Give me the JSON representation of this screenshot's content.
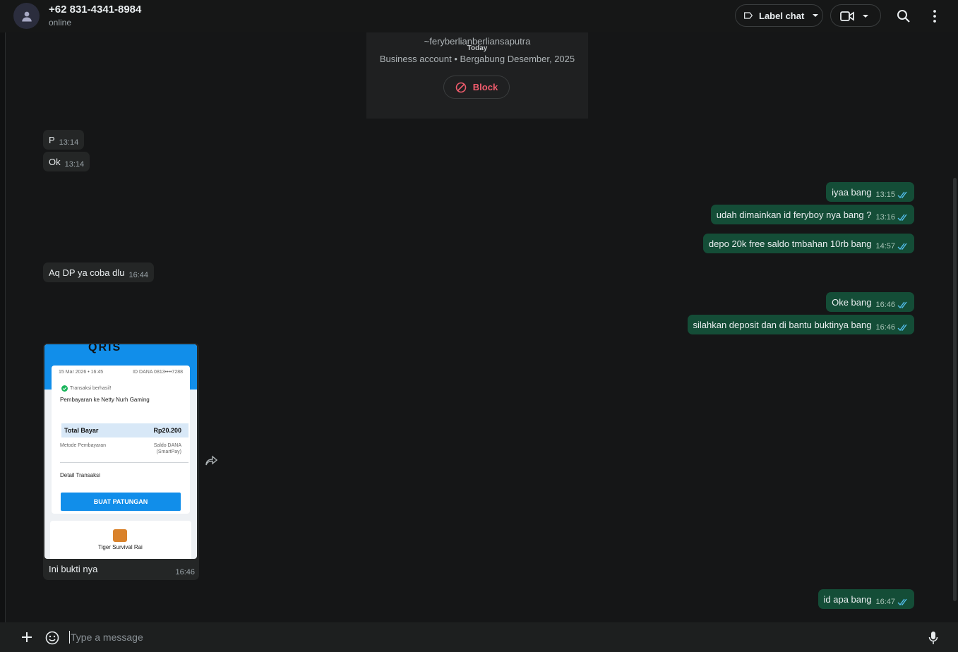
{
  "header": {
    "contact_name": "+62 831-4341-8984",
    "status": "online",
    "label_chat": "Label chat",
    "icons": [
      "person-icon",
      "label-icon",
      "chevron-down-icon",
      "video-icon",
      "search-icon",
      "more-vertical-icon"
    ]
  },
  "business_card": {
    "username": "~feryberlianberliansaputra",
    "date_divider": "Today",
    "info": "Business account • Bergabung Desember, 2025",
    "block_label": "Block"
  },
  "messages": [
    {
      "dir": "in",
      "text": "P",
      "time": "13:14"
    },
    {
      "dir": "in",
      "text": "Ok",
      "time": "13:14"
    },
    {
      "dir": "out",
      "text": "iyaa bang",
      "time": "13:15"
    },
    {
      "dir": "out",
      "text": "udah dimainkan id feryboy nya bang ?",
      "time": "13:16"
    },
    {
      "dir": "out",
      "text": "depo 20k free saldo tmbahan 10rb bang",
      "time": "14:57"
    },
    {
      "dir": "in",
      "text": "Aq DP ya coba dlu",
      "time": "16:44"
    },
    {
      "dir": "out",
      "text": "Oke bang",
      "time": "16:46"
    },
    {
      "dir": "out",
      "text": "silahkan deposit dan di bantu buktinya bang",
      "time": "16:46"
    },
    {
      "dir": "out",
      "text": "id apa bang",
      "time": "16:47"
    }
  ],
  "image_message": {
    "caption": "Ini bukti nya",
    "time": "16:46",
    "receipt": {
      "brand": "QRIS",
      "date": "15 Mar 2026 • 16:45",
      "dana_id": "ID DANA 0813••••7288",
      "status": "Transaksi berhasil!",
      "title": "Pembayaran ke Netty Nurh Gaming",
      "total_label": "Total Bayar",
      "total_value": "Rp20.200",
      "method_label": "Metode Pembayaran",
      "method_value": "Saldo DANA",
      "method_sub": "(SmartPay)",
      "detail_label": "Detail Transaksi",
      "button_label": "BUAT PATUNGAN",
      "game_name": "Tiger Survival Rai"
    }
  },
  "composer": {
    "placeholder": "Type a message"
  },
  "colors": {
    "background": "#161717",
    "incoming_bubble": "#242626",
    "outgoing_bubble": "#144d37",
    "block_red": "#f15c6d",
    "read_ticks": "#53bdeb"
  }
}
